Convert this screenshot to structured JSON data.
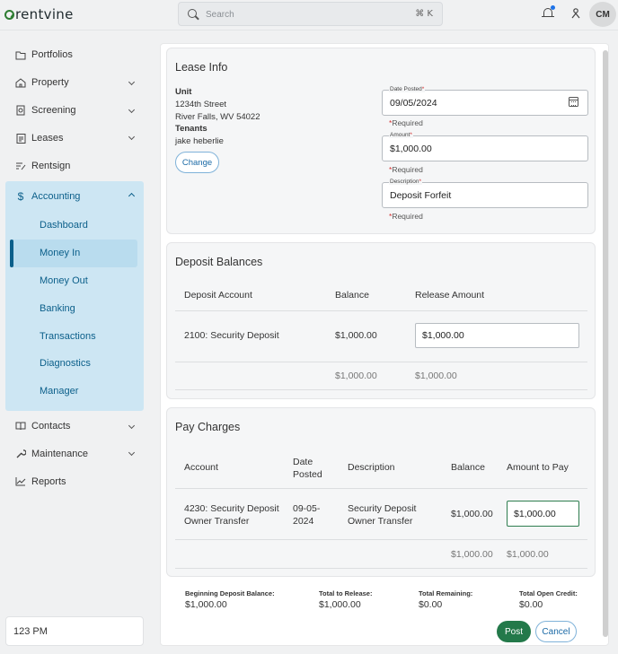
{
  "app": {
    "logo_text": "rentvine"
  },
  "search": {
    "placeholder": "Search",
    "shortcut": "⌘ K"
  },
  "user": {
    "initials": "CM"
  },
  "sidebar": {
    "items": [
      {
        "label": "Portfolios",
        "icon": "folder-icon"
      },
      {
        "label": "Property",
        "icon": "house-icon"
      },
      {
        "label": "Screening",
        "icon": "screening-icon"
      },
      {
        "label": "Leases",
        "icon": "clipboard-icon"
      },
      {
        "label": "Rentsign",
        "icon": "sign-icon"
      },
      {
        "label": "Accounting",
        "icon": "dollar-icon"
      }
    ],
    "accounting_sub": [
      "Dashboard",
      "Money In",
      "Money Out",
      "Banking",
      "Transactions",
      "Diagnostics",
      "Manager"
    ],
    "active_sub": "Money In",
    "bottom_items": [
      {
        "label": "Contacts",
        "icon": "book-icon"
      },
      {
        "label": "Maintenance",
        "icon": "wrench-icon"
      },
      {
        "label": "Reports",
        "icon": "chart-icon"
      }
    ],
    "time": "123 PM"
  },
  "lease_info": {
    "title": "Lease Info",
    "unit_label": "Unit",
    "unit_line1": "1234th Street",
    "unit_line2": "River Falls, WV 54022",
    "tenants_label": "Tenants",
    "tenant_name": "jake heberlie",
    "change_label": "Change",
    "date_label": "Date Posted",
    "date_value": "09/05/2024",
    "amount_label": "Amount",
    "amount_value": "$1,000.00",
    "description_label": "Description",
    "description_value": "Deposit Forfeit",
    "required_text": "Required",
    "star": "*"
  },
  "deposit_balances": {
    "title": "Deposit Balances",
    "headers": [
      "Deposit Account",
      "Balance",
      "Release Amount"
    ],
    "row": {
      "account": "2100: Security Deposit",
      "balance": "$1,000.00",
      "release": "$1,000.00"
    },
    "totals": {
      "balance": "$1,000.00",
      "release": "$1,000.00"
    }
  },
  "pay_charges": {
    "title": "Pay Charges",
    "headers": {
      "account": "Account",
      "date_line1": "Date",
      "date_line2": "Posted",
      "description": "Description",
      "balance": "Balance",
      "amount": "Amount to Pay"
    },
    "row": {
      "account_line1": "4230: Security Deposit",
      "account_line2": "Owner Transfer",
      "date_line1": "09-05-",
      "date_line2": "2024",
      "desc_line1": "Security Deposit",
      "desc_line2": "Owner Transfer",
      "balance": "$1,000.00",
      "amount": "$1,000.00"
    },
    "totals": {
      "balance": "$1,000.00",
      "amount": "$1,000.00"
    }
  },
  "summary": {
    "beginning_label": "Beginning Deposit Balance:",
    "beginning_value": "$1,000.00",
    "release_label": "Total to Release:",
    "release_value": "$1,000.00",
    "remaining_label": "Total Remaining:",
    "remaining_value": "$0.00",
    "credit_label": "Total Open Credit:",
    "credit_value": "$0.00"
  },
  "actions": {
    "post_label": "Post",
    "cancel_label": "Cancel"
  },
  "colors": {
    "brand_green": "#23794a",
    "nav_active_bg": "#cde6f3",
    "link_blue": "#1b6aa6"
  }
}
